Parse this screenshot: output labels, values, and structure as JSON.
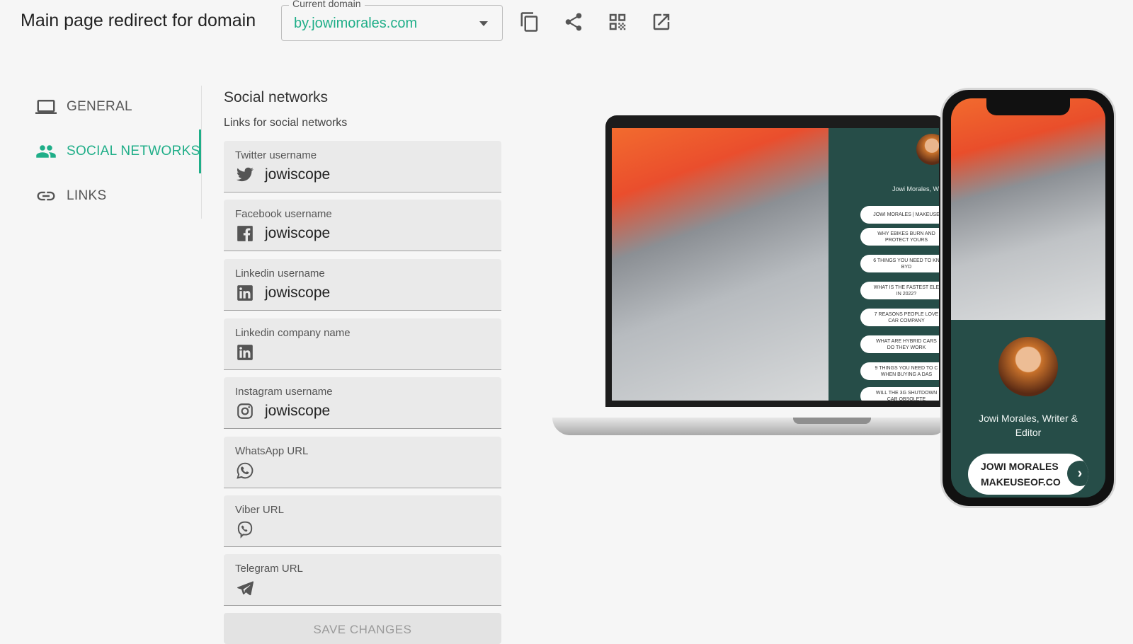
{
  "header": {
    "title": "Main page redirect for domain",
    "domain_label": "Current domain",
    "domain_value": "by.jowimorales.com",
    "icons": [
      "copy-icon",
      "share-icon",
      "qr-code-icon",
      "open-external-icon"
    ]
  },
  "sidebar": {
    "items": [
      {
        "label": "GENERAL",
        "icon": "laptop-icon",
        "active": false
      },
      {
        "label": "SOCIAL NETWORKS",
        "icon": "people-icon",
        "active": true
      },
      {
        "label": "LINKS",
        "icon": "link-icon",
        "active": false
      }
    ]
  },
  "form": {
    "title": "Social networks",
    "subtitle": "Links for social networks",
    "fields": [
      {
        "label": "Twitter username",
        "value": "jowiscope",
        "icon": "twitter-icon"
      },
      {
        "label": "Facebook username",
        "value": "jowiscope",
        "icon": "facebook-icon"
      },
      {
        "label": "Linkedin username",
        "value": "jowiscope",
        "icon": "linkedin-icon"
      },
      {
        "label": "Linkedin company name",
        "value": "",
        "icon": "linkedin-icon"
      },
      {
        "label": "Instagram username",
        "value": "jowiscope",
        "icon": "instagram-icon"
      },
      {
        "label": "WhatsApp URL",
        "value": "",
        "icon": "whatsapp-icon"
      },
      {
        "label": "Viber URL",
        "value": "",
        "icon": "viber-icon"
      },
      {
        "label": "Telegram URL",
        "value": "",
        "icon": "telegram-icon"
      }
    ],
    "save_label": "SAVE CHANGES"
  },
  "preview": {
    "laptop": {
      "name": "Jowi Morales, W",
      "links": [
        "JOWI MORALES | MAKEUSE",
        "WHY EBIKES BURN AND\nPROTECT YOURS",
        "6 THINGS YOU NEED TO KN\nBYD",
        "WHAT IS THE FASTEST ELE\nIN 2022?",
        "7 REASONS PEOPLE LOVE\nCAR COMPANY",
        "WHAT ARE HYBRID CARS\nDO THEY WORK",
        "9 THINGS YOU NEED TO C\nWHEN BUYING A DAS",
        "WILL THE 3G SHUTDOWN\nCAR OBSOLETE"
      ]
    },
    "phone": {
      "name_line1": "Jowi Morales, Writer &",
      "name_line2": "Editor",
      "button_line1": "JOWI MORALES",
      "button_line2": "MAKEUSEOF.CO",
      "arrow": "›"
    }
  },
  "colors": {
    "accent": "#1fae88",
    "preview_bg": "#264d48"
  }
}
